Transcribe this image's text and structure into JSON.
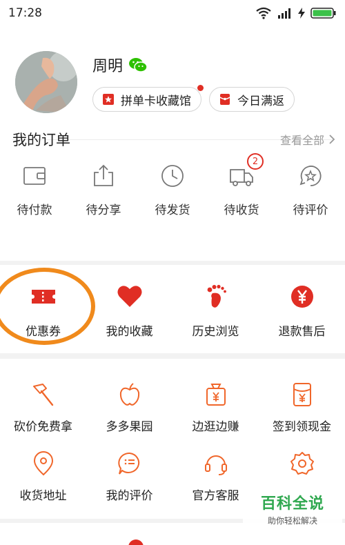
{
  "status_bar": {
    "time": "17:28"
  },
  "profile": {
    "name": "周明",
    "pills": [
      {
        "label": "拼单卡收藏馆",
        "has_dot": true
      },
      {
        "label": "今日满返"
      }
    ]
  },
  "orders": {
    "title": "我的订单",
    "view_all": "查看全部",
    "items": [
      {
        "label": "待付款"
      },
      {
        "label": "待分享"
      },
      {
        "label": "待发货"
      },
      {
        "label": "待收货",
        "badge": "2"
      },
      {
        "label": "待评价"
      }
    ]
  },
  "quick": {
    "items": [
      {
        "label": "优惠券"
      },
      {
        "label": "我的收藏"
      },
      {
        "label": "历史浏览"
      },
      {
        "label": "退款售后"
      }
    ]
  },
  "services": {
    "row1": [
      {
        "label": "砍价免费拿"
      },
      {
        "label": "多多果园"
      },
      {
        "label": "边逛边赚"
      },
      {
        "label": "签到领现金"
      }
    ],
    "row2": [
      {
        "label": "收货地址"
      },
      {
        "label": "我的评价"
      },
      {
        "label": "官方客服"
      },
      {
        "label": ""
      }
    ]
  },
  "watermark": {
    "title": "百科全说",
    "subtitle": "助你轻松解决"
  },
  "colors": {
    "accent": "#e02e24",
    "icon_orange": "#f0662a",
    "highlight": "#f08a1c",
    "watermark": "#2fa84f"
  }
}
